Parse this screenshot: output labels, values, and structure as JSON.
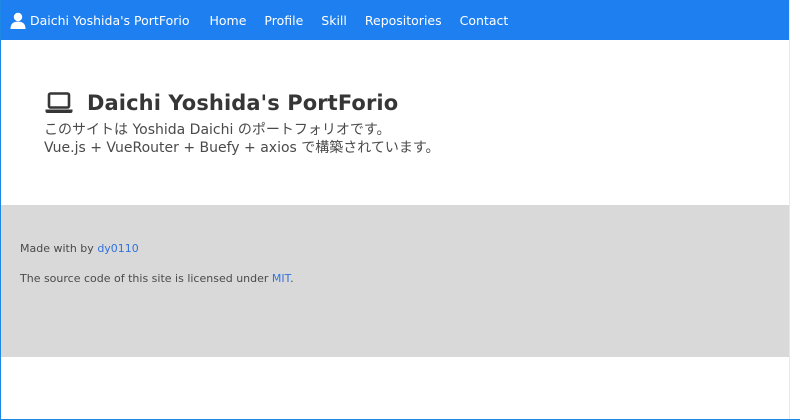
{
  "navbar": {
    "brand": "Daichi Yoshida's PortForio",
    "brand_icon": "user-icon",
    "items": [
      {
        "label": "Home"
      },
      {
        "label": "Profile"
      },
      {
        "label": "Skill"
      },
      {
        "label": "Repositories"
      },
      {
        "label": "Contact"
      }
    ],
    "color": "#1e7ff0"
  },
  "hero": {
    "icon": "laptop-icon",
    "title": "Daichi Yoshida's PortForio",
    "line1": "このサイトは Yoshida Daichi のポートフォリオです。",
    "line2": "Vue.js + VueRouter + Buefy + axios で構築されています。"
  },
  "footer": {
    "made_with_prefix": "Made with by ",
    "author_link": "dy0110",
    "license_prefix": "The source code of this site is licensed under ",
    "license_link": "MIT",
    "license_suffix": ".",
    "background": "#d9d9d9",
    "link_color": "#3273dc"
  }
}
